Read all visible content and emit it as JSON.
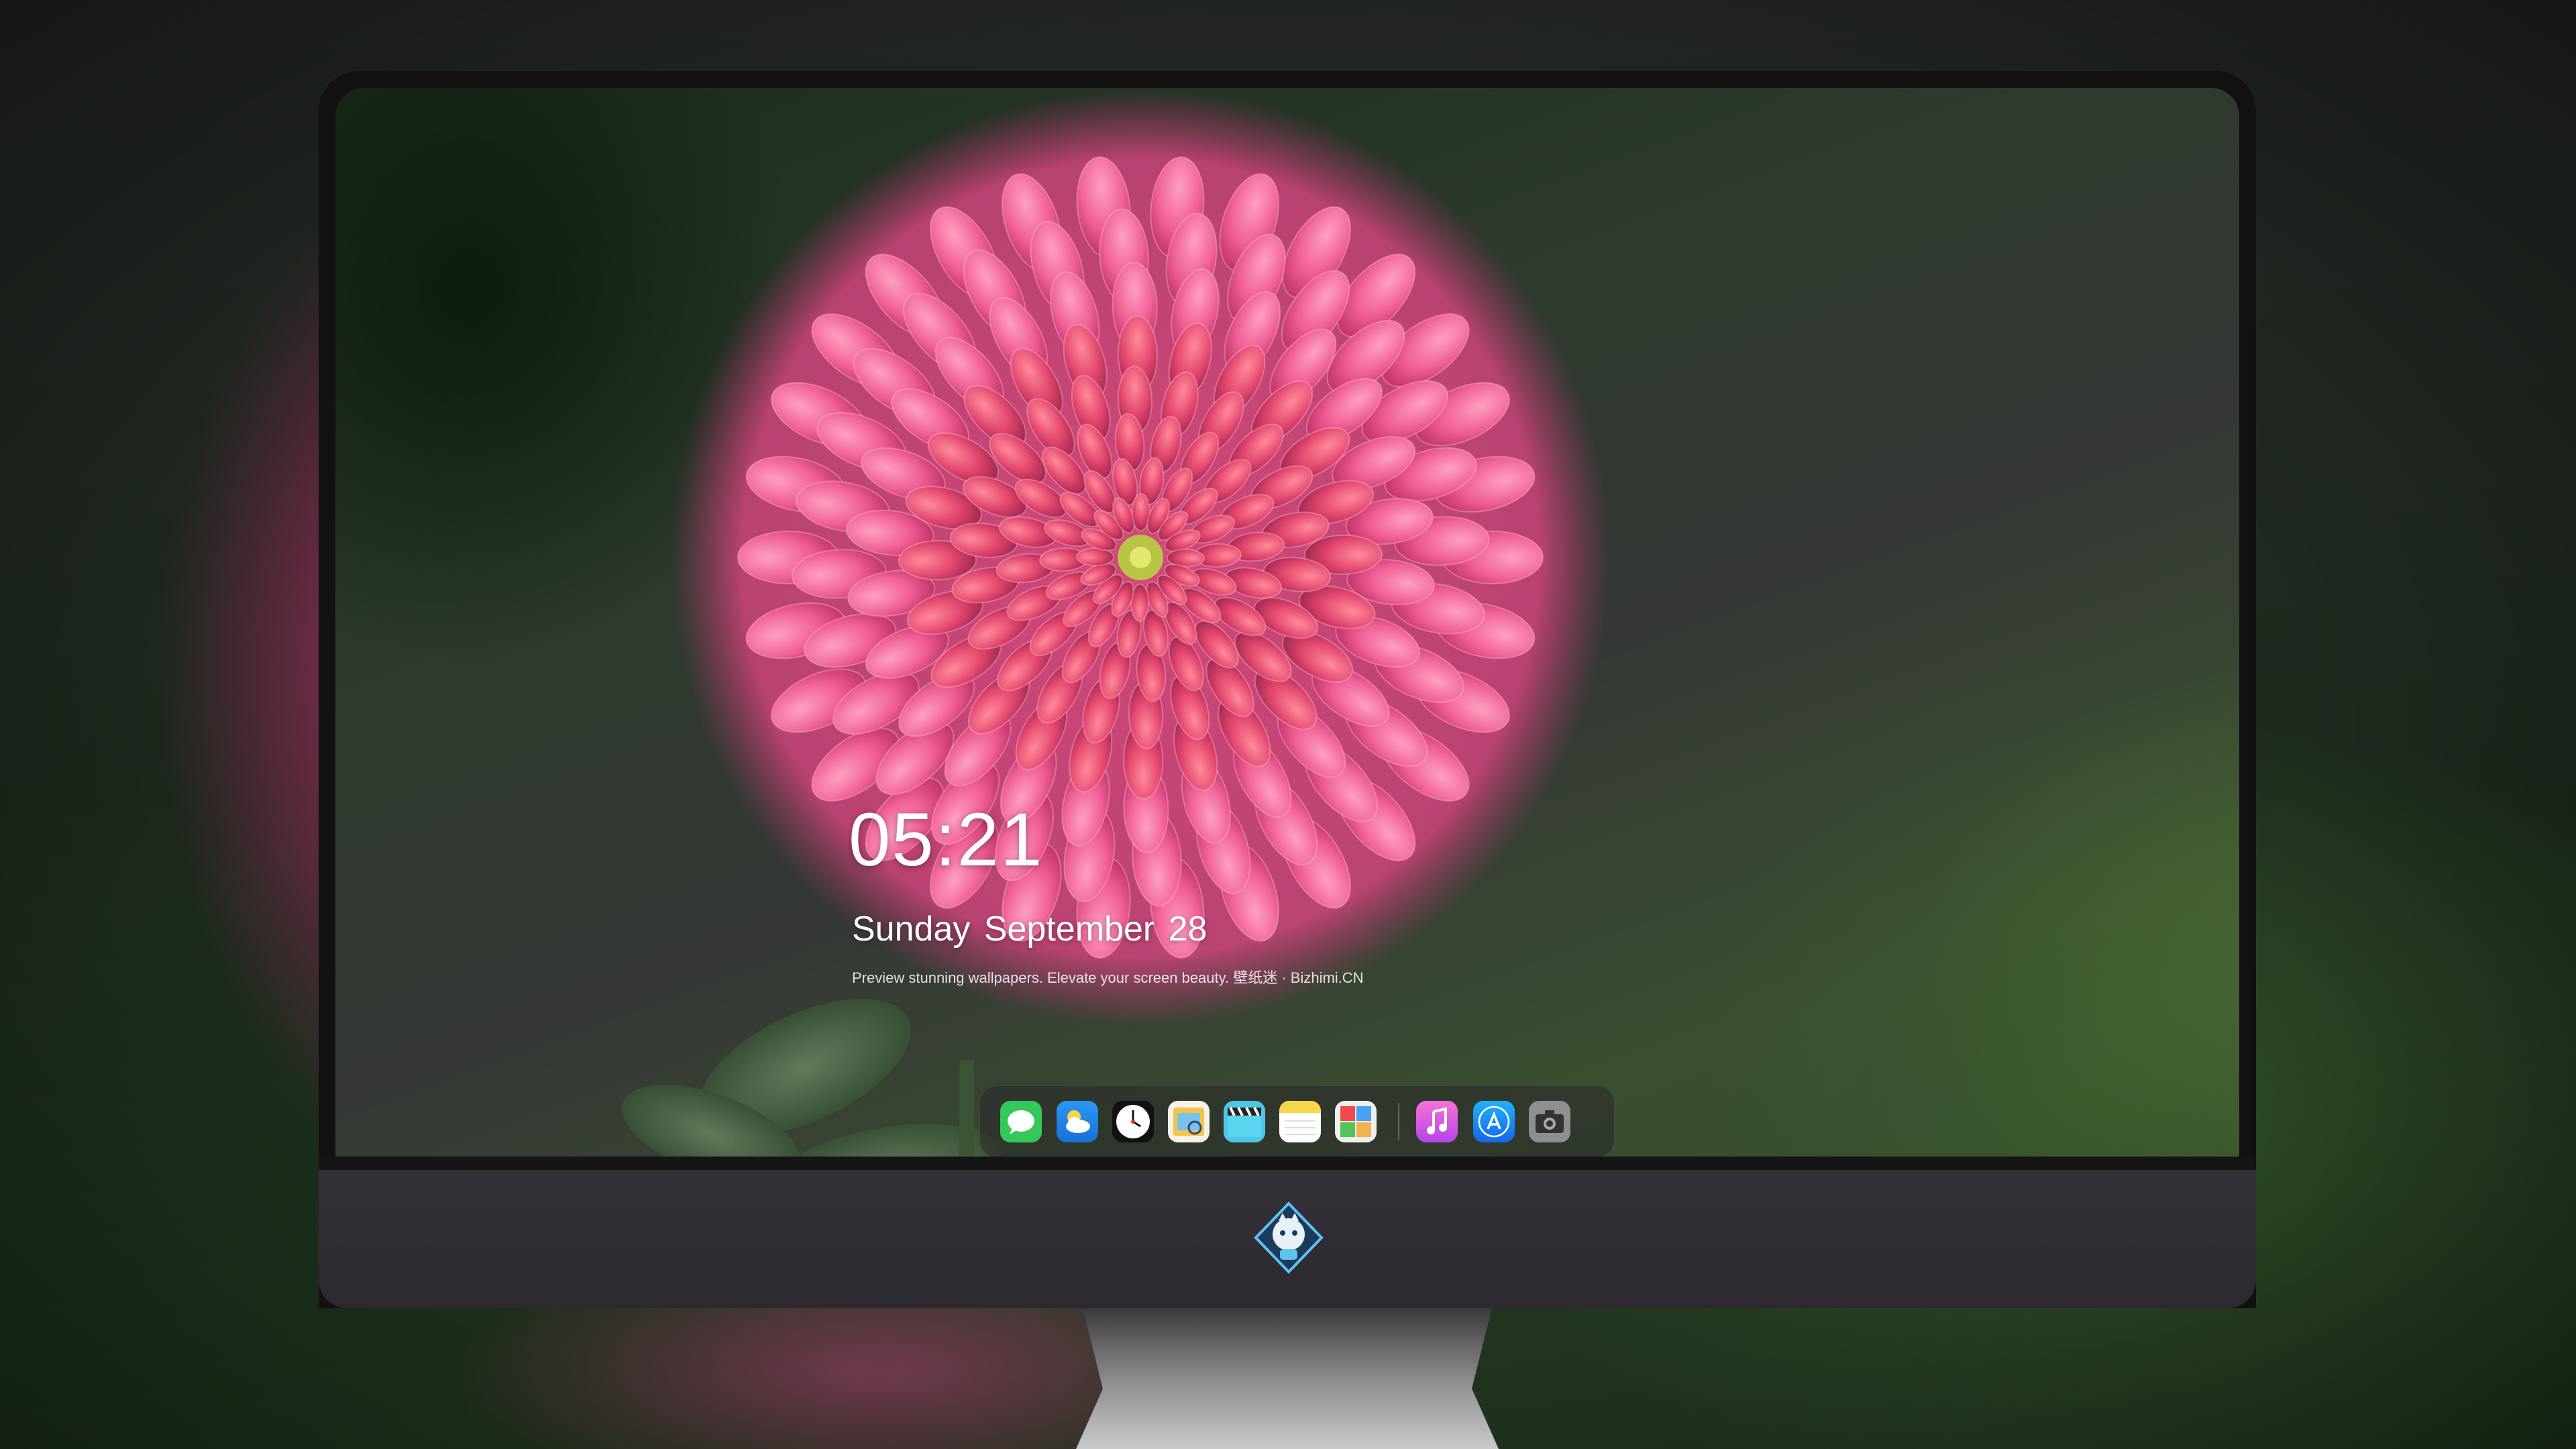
{
  "lock_screen": {
    "time": "05:21",
    "date": "Sunday September  28",
    "tagline": "Preview stunning wallpapers. Elevate your screen beauty. 壁纸迷 · Bizhimi.CN"
  },
  "dock": {
    "apps": [
      {
        "name": "messages-icon",
        "color": "#34c759"
      },
      {
        "name": "weather-icon",
        "color": "#1f8cf0"
      },
      {
        "name": "clock-icon",
        "color": "#111111"
      },
      {
        "name": "preview-icon",
        "color": "#f2c44b"
      },
      {
        "name": "video-icon",
        "color": "#4fc7e8"
      },
      {
        "name": "notes-icon",
        "color": "#f7d64a"
      },
      {
        "name": "photos-icon",
        "color": "#f0f0f0"
      },
      {
        "name": "music-icon",
        "color": "#e24fdc"
      },
      {
        "name": "app-store-icon",
        "color": "#1a8af5"
      },
      {
        "name": "camera-icon",
        "color": "#8e8e93"
      }
    ]
  },
  "colors": {
    "petal_outer": "#f06a9e",
    "petal_inner": "#d9406b",
    "flower_center": "#c7d24a"
  }
}
